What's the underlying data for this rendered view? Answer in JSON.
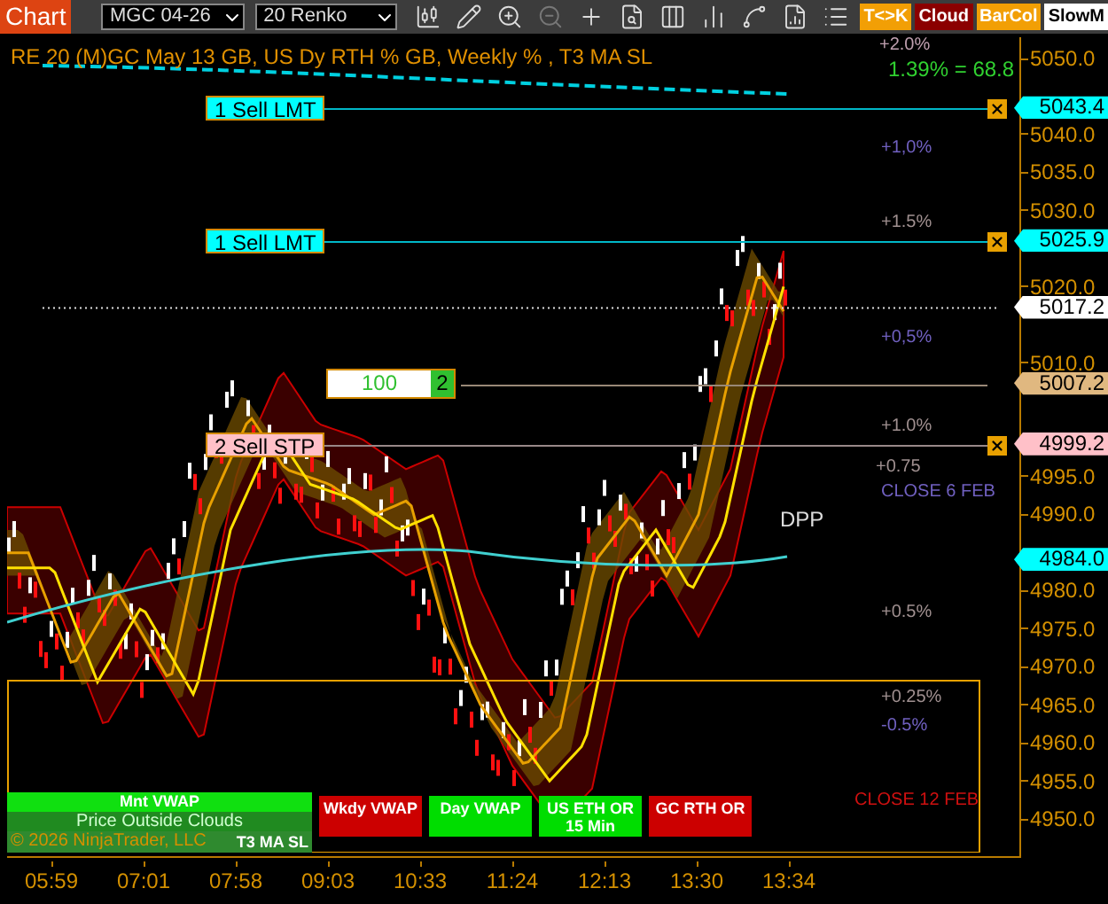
{
  "toolbar": {
    "tab": "Chart",
    "instrument": "MGC 04-26",
    "bar_type": "20 Renko",
    "buttons": [
      {
        "label": "T<>K",
        "color": "#f29f05"
      },
      {
        "label": "Cloud",
        "color": "#8b0000"
      },
      {
        "label": "BarCol",
        "color": "#f29f05"
      },
      {
        "label": "SlowM",
        "color": "#ffffff"
      }
    ]
  },
  "chart": {
    "title": "RE 20  (M)GC May 13 GB, US Dy RTH % GB, Weekly % , T3 MA SL",
    "summary": "1.39% = 68.8",
    "level_labels": [
      {
        "text": "+2.0%",
        "color": "#c0a0b0"
      },
      {
        "text": "+1,0%",
        "color": "#7060c0"
      },
      {
        "text": "+1.5%",
        "color": "#a09090"
      },
      {
        "text": "+0,5%",
        "color": "#7060c0"
      },
      {
        "text": "+1.0%",
        "color": "#a09090"
      },
      {
        "text": "+0.75",
        "color": "#a09090"
      },
      {
        "text": "CLOSE 6 FEB",
        "color": "#7060c0"
      },
      {
        "text": "+0.5%",
        "color": "#a09090"
      },
      {
        "text": "+0.25%",
        "color": "#a09090"
      },
      {
        "text": "-0.5%",
        "color": "#7060c0"
      },
      {
        "text": "CLOSE 12 FEB",
        "color": "#d01010"
      }
    ],
    "dpp_label": "DPP",
    "orders": [
      {
        "label": "1 Sell LMT",
        "kind": "limit"
      },
      {
        "label": "1 Sell LMT",
        "kind": "limit"
      },
      {
        "label": "2 Sell STP",
        "kind": "stop"
      }
    ],
    "quantity": {
      "value": "100",
      "count": "2"
    },
    "indicator_panel": {
      "items": [
        "Mnt VWAP",
        "Price Outside Clouds",
        "T3 MA SL"
      ],
      "copyright": "© 2026 NinjaTrader, LLC"
    },
    "signals": [
      {
        "label": "Wkdy VWAP",
        "color": "#cc0000"
      },
      {
        "label": "Day VWAP",
        "color": "#00dd00"
      },
      {
        "label": "US ETH OR 15 Min",
        "color": "#00dd00"
      },
      {
        "label": "GC RTH OR",
        "color": "#cc0000"
      }
    ]
  },
  "price_axis": {
    "labels": [
      "5050.0",
      "5040.0",
      "5035.0",
      "5030.0",
      "5020.0",
      "5010.0",
      "4995.0",
      "4990.0",
      "4980.0",
      "4975.0",
      "4970.0",
      "4965.0",
      "4960.0",
      "4955.0",
      "4950.0"
    ],
    "tags": [
      {
        "text": "5043.4",
        "color": "#00ffff"
      },
      {
        "text": "5025.9",
        "color": "#00ffff"
      },
      {
        "text": "5017.2",
        "color": "#ffffff"
      },
      {
        "text": "5007.2",
        "color": "#e0b880"
      },
      {
        "text": "4999.2",
        "color": "#ffc0c8"
      },
      {
        "text": "4984.0",
        "color": "#00ffff"
      }
    ]
  },
  "time_axis": {
    "labels": [
      "05:59",
      "07:01",
      "07:58",
      "09:03",
      "10:33",
      "11:24",
      "12:13",
      "13:30",
      "13:34"
    ]
  }
}
